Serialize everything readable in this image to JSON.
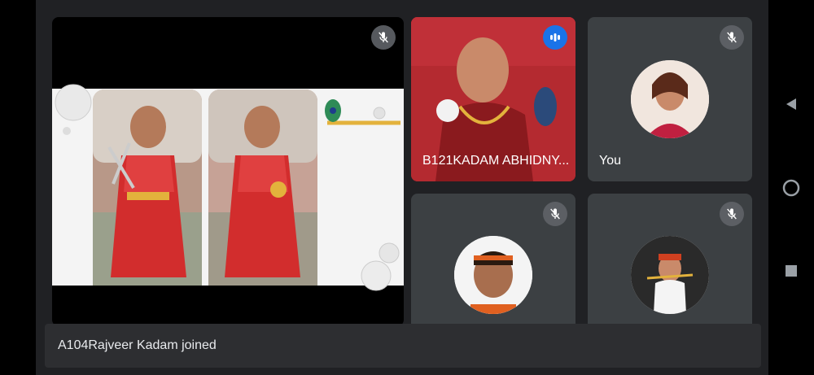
{
  "tiles": {
    "main": {
      "content": "screen-share-photo"
    },
    "speaker": {
      "name": "B121KADAM ABHIDNY..."
    },
    "self": {
      "name": "You"
    }
  },
  "notification": {
    "text": "A104Rajveer Kadam joined"
  },
  "icons": {
    "mute": "mic-off-icon",
    "speaking": "speaking-indicator-icon",
    "back": "back-icon",
    "home": "home-icon",
    "recents": "recents-icon"
  },
  "colors": {
    "stage": "#202124",
    "tile": "#3c4043",
    "speaking": "#1a73e8"
  }
}
